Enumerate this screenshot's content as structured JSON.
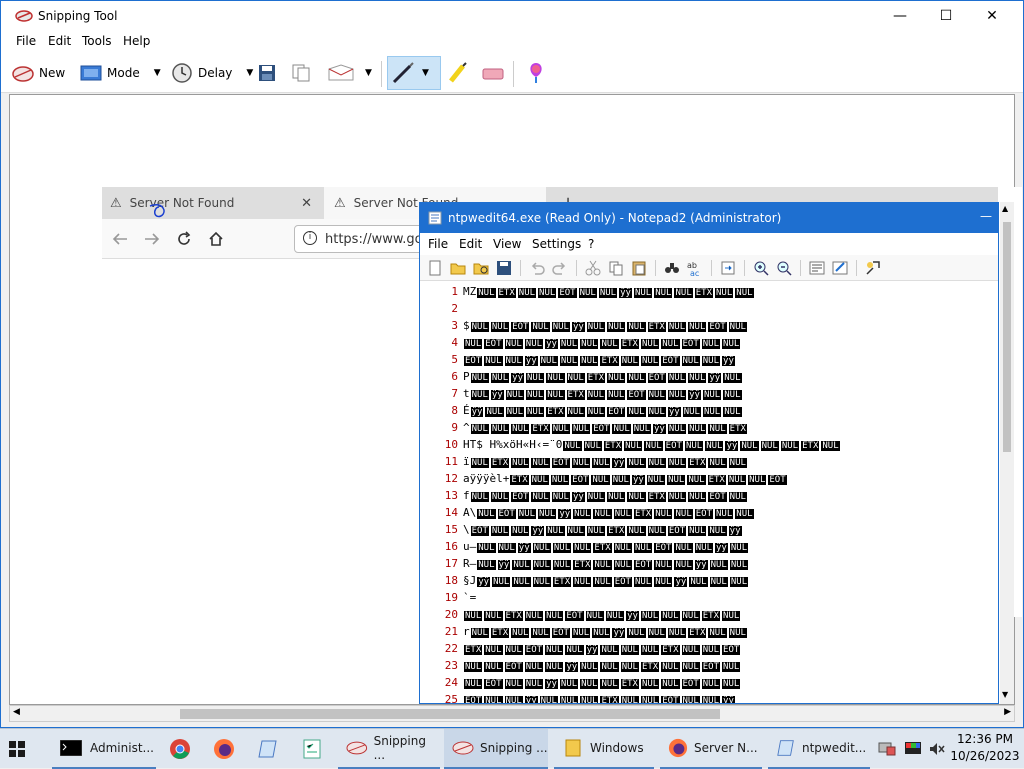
{
  "snipping_tool": {
    "title": "Snipping Tool",
    "menu": [
      "File",
      "Edit",
      "Tools",
      "Help"
    ],
    "toolbar": {
      "new": "New",
      "mode": "Mode",
      "delay": "Delay"
    }
  },
  "browser": {
    "tab1": "Server Not Found",
    "tab2": "Server Not Found",
    "url": "https://www.go"
  },
  "notepad": {
    "title": "ntpwedit64.exe (Read Only) - Notepad2 (Administrator)",
    "menu": [
      "File",
      "Edit",
      "View",
      "Settings",
      "?"
    ],
    "lines": [
      {
        "n": "1",
        "t": "MZ"
      },
      {
        "n": "2",
        "t": ""
      },
      {
        "n": "3",
        "t": "$"
      },
      {
        "n": "4",
        "t": ""
      },
      {
        "n": "5",
        "t": ""
      },
      {
        "n": "6",
        "t": "P"
      },
      {
        "n": "7",
        "t": "t"
      },
      {
        "n": "8",
        "t": "É"
      },
      {
        "n": "9",
        "t": " ^"
      },
      {
        "n": "10",
        "t": "HT$ H%xöH«H‹=¨0"
      },
      {
        "n": "11",
        "t": "ï"
      },
      {
        "n": "12",
        "t": "aÿÿÿèl+"
      },
      {
        "n": "13",
        "t": "f"
      },
      {
        "n": "14",
        "t": "A\\"
      },
      {
        "n": "15",
        "t": "\\"
      },
      {
        "n": "16",
        "t": "u–"
      },
      {
        "n": "17",
        "t": "R–"
      },
      {
        "n": "18",
        "t": "§J"
      },
      {
        "n": "19",
        "t": "`="
      },
      {
        "n": "20",
        "t": ""
      },
      {
        "n": "21",
        "t": "r"
      },
      {
        "n": "22",
        "t": ""
      },
      {
        "n": "23",
        "t": ""
      },
      {
        "n": "24",
        "t": ""
      },
      {
        "n": "25",
        "t": ""
      }
    ]
  },
  "taskbar": {
    "items": [
      "Administ...",
      "Snipping ...",
      "Snipping ...",
      "Windows",
      "Server N...",
      "ntpwedit..."
    ],
    "time": "12:36 PM",
    "date": "10/26/2023"
  }
}
